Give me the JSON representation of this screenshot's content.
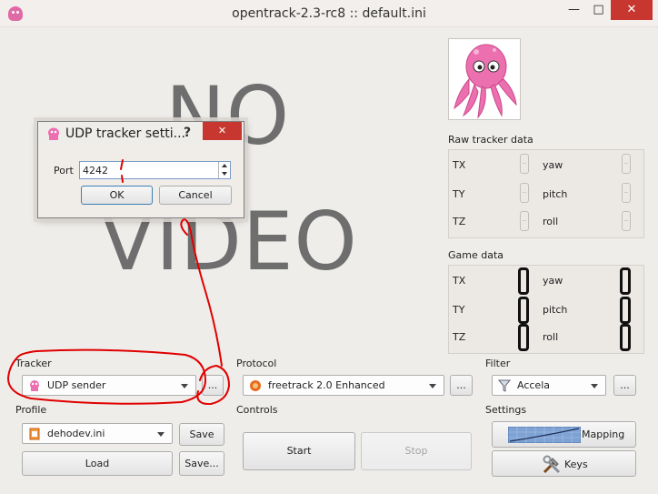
{
  "window": {
    "title": "opentrack-2.3-rc8 :: default.ini",
    "minimize_glyph": "—",
    "maximize_glyph": "□",
    "close_glyph": "✕"
  },
  "video": {
    "no_text": "NO",
    "video_text": "VIDEO"
  },
  "raw_tracker": {
    "label": "Raw tracker data",
    "axes": {
      "tx": "TX",
      "ty": "TY",
      "tz": "TZ",
      "yaw": "yaw",
      "pitch": "pitch",
      "roll": "roll"
    }
  },
  "game_data": {
    "label": "Game data",
    "axes": {
      "tx": "TX",
      "ty": "TY",
      "tz": "TZ",
      "yaw": "yaw",
      "pitch": "pitch",
      "roll": "roll"
    },
    "values": {
      "tx": 0,
      "ty": 0,
      "tz": 0,
      "yaw": 0,
      "pitch": 0,
      "roll": 0
    }
  },
  "tracker": {
    "label": "Tracker",
    "selected": "UDP sender",
    "settings_button": "..."
  },
  "protocol": {
    "label": "Protocol",
    "selected": "freetrack 2.0 Enhanced",
    "settings_button": "..."
  },
  "filter": {
    "label": "Filter",
    "selected": "Accela",
    "settings_button": "..."
  },
  "profile": {
    "label": "Profile",
    "selected": "dehodev.ini",
    "save": "Save",
    "load": "Load",
    "save_as": "Save..."
  },
  "controls": {
    "label": "Controls",
    "start": "Start",
    "stop": "Stop"
  },
  "settings": {
    "label": "Settings",
    "mapping": "Mapping",
    "keys": "Keys"
  },
  "dialog": {
    "title": "UDP tracker setti...",
    "help_glyph": "?",
    "close_glyph": "✕",
    "port_label": "Port",
    "port_value": "4242",
    "ok": "OK",
    "cancel": "Cancel"
  },
  "colors": {
    "annotation": "#e00000",
    "close_button": "#c7372f",
    "octopus": "#ec6fb0"
  },
  "icons": {
    "app": "octopus-icon",
    "tracker": "octopus-icon",
    "protocol": "freetrack-icon",
    "filter": "funnel-icon",
    "profile": "ini-file-icon",
    "mapping": "curve-graph-icon",
    "keys": "tools-icon"
  }
}
